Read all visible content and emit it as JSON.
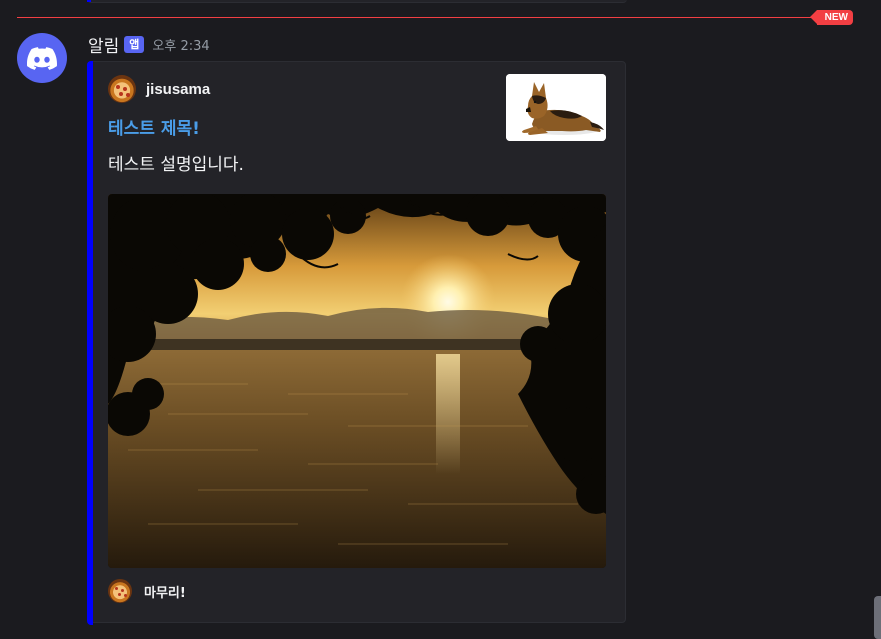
{
  "divider": {
    "badge": "NEW"
  },
  "message": {
    "username": "알림",
    "tag": "앱",
    "timestamp": "오후 2:34",
    "avatar_icon": "discord-logo-icon",
    "embed": {
      "accent_color": "#0000ff",
      "author": {
        "name": "jisusama",
        "icon": "pizza-avatar-icon"
      },
      "title": "테스트 제목!",
      "description": "테스트 설명입니다.",
      "thumbnail": "german-shepherd-dog-image",
      "image": "lake-sunset-image",
      "footer": {
        "text": "마무리!",
        "icon": "pizza-icon"
      }
    }
  },
  "colors": {
    "background": "#1b1b1f",
    "divider_red": "#f23f43",
    "blurple": "#5865f2",
    "title_link": "#4a9de8"
  }
}
